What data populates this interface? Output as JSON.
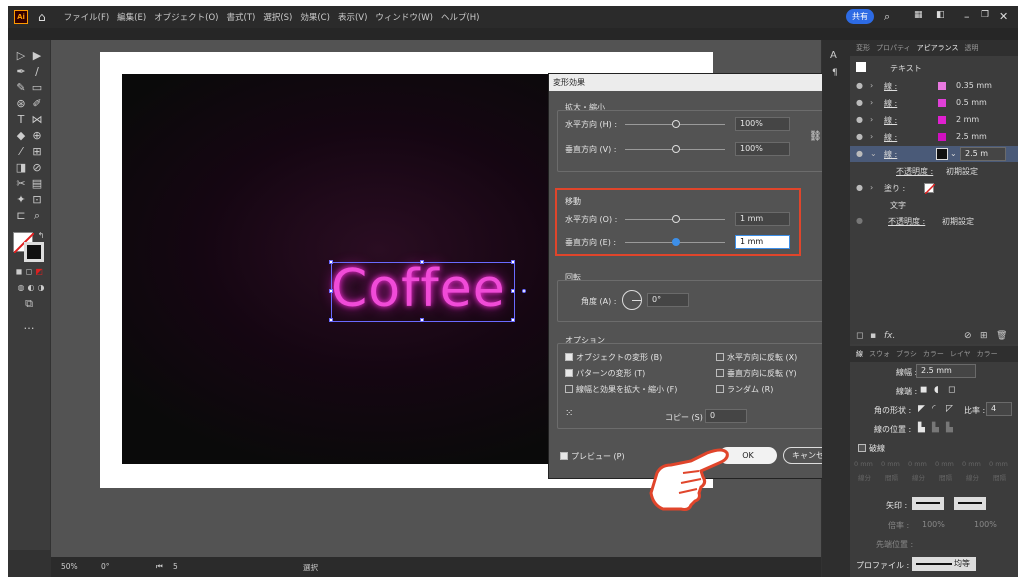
{
  "menubar": {
    "app_badge": "Ai",
    "items": [
      "ファイル(F)",
      "編集(E)",
      "オブジェクト(O)",
      "書式(T)",
      "選択(S)",
      "効果(C)",
      "表示(V)",
      "ウィンドウ(W)",
      "ヘルプ(H)"
    ],
    "share": "共有"
  },
  "artwork": {
    "text": "Coffee"
  },
  "dialog": {
    "title": "変形効果",
    "scale": {
      "label": "拡大・縮小",
      "horizontal_label": "水平方向 (H) :",
      "horizontal_value": "100%",
      "vertical_label": "垂直方向 (V) :",
      "vertical_value": "100%"
    },
    "move": {
      "label": "移動",
      "horizontal_label": "水平方向 (O) :",
      "horizontal_value": "1 mm",
      "vertical_label": "垂直方向 (E) :",
      "vertical_value": "1 mm"
    },
    "rotate": {
      "label": "回転",
      "angle_label": "角度 (A) :",
      "angle_value": "0°"
    },
    "options": {
      "label": "オプション",
      "transform_objects": "オブジェクトの変形 (B)",
      "transform_patterns": "パターンの変形 (T)",
      "scale_strokes": "線幅と効果を拡大・縮小 (F)",
      "reflect_x": "水平方向に反転 (X)",
      "reflect_y": "垂直方向に反転 (Y)",
      "random": "ランダム (R)",
      "copies_label": "コピー (S)",
      "copies_value": "0"
    },
    "preview": "プレビュー (P)",
    "ok": "OK",
    "cancel": "キャンセル"
  },
  "appearance": {
    "tabs": [
      "変形",
      "プロパティ",
      "アピアランス",
      "透明"
    ],
    "header": "テキスト",
    "strokes": [
      {
        "label": "線 :",
        "value": "0.35 mm",
        "color": "#e879e0"
      },
      {
        "label": "線 :",
        "value": "0.5 mm",
        "color": "#e040d8"
      },
      {
        "label": "線 :",
        "value": "2 mm",
        "color": "#e020d0"
      },
      {
        "label": "線 :",
        "value": "2.5 mm",
        "color": "#d010c0"
      },
      {
        "label": "線 :",
        "value": "2.5 m"
      }
    ],
    "opacity_label": "不透明度 :",
    "opacity_value": "初期設定",
    "fill_label": "塗り :",
    "char_label": "文字",
    "opacity_label2": "不透明度 :",
    "opacity_value2": "初期設定"
  },
  "stroke_panel": {
    "tabs": [
      "線",
      "スウォ",
      "ブラシ",
      "カラー",
      "レイヤ",
      "カラー"
    ],
    "weight_label": "線幅 :",
    "weight_value": "2.5 mm",
    "cap_label": "線端 :",
    "corner_label": "角の形状 :",
    "limit_label": "比率 :",
    "limit_value": "4",
    "align_label": "線の位置 :",
    "dashed_label": "破線",
    "dash_fields": [
      "0 mm",
      "0 mm",
      "0 mm",
      "0 mm",
      "0 mm",
      "0 mm"
    ],
    "dash_labels": [
      "線分",
      "間隔",
      "線分",
      "間隔",
      "線分",
      "間隔"
    ],
    "arrow_label": "矢印 :",
    "scale_label": "倍率 :",
    "scale1": "100%",
    "scale2": "100%",
    "align_arrow_label": "先端位置 :",
    "profile_label": "プロファイル :",
    "profile_value": "均等"
  },
  "status": {
    "zoom": "50%",
    "angle": "0°",
    "page": "5",
    "mode": "選択"
  }
}
